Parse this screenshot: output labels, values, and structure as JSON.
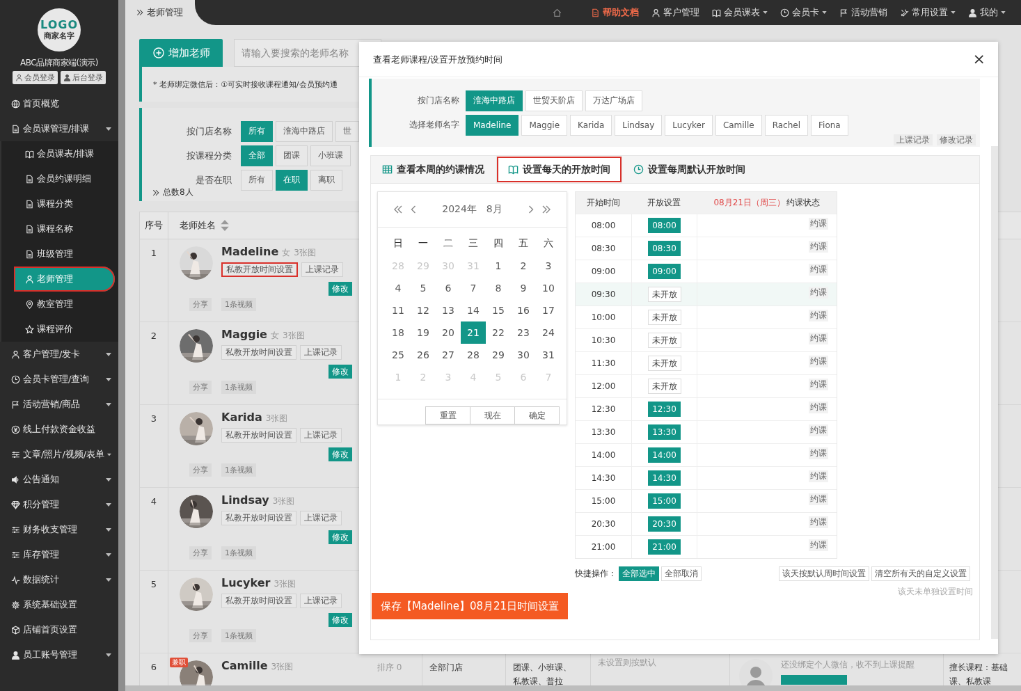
{
  "sidebar": {
    "logo": {
      "mark": "LOGO",
      "name": "商家名字"
    },
    "brand": "ABC品牌商家端(演示)",
    "login_buttons": [
      "会员登录",
      "后台登录"
    ],
    "menu": [
      {
        "label": "首页概览",
        "caret": false
      },
      {
        "label": "会员课管理/排课",
        "caret": true,
        "children": [
          {
            "label": "会员课表/排课",
            "selected": false,
            "highlighted": false
          },
          {
            "label": "会员约课明细",
            "selected": false,
            "highlighted": false
          },
          {
            "label": "课程分类",
            "selected": false,
            "highlighted": false
          },
          {
            "label": "课程名称",
            "selected": false,
            "highlighted": false
          },
          {
            "label": "班级管理",
            "selected": false,
            "highlighted": false
          },
          {
            "label": "老师管理",
            "selected": true,
            "highlighted": true
          },
          {
            "label": "教室管理",
            "selected": false,
            "highlighted": false
          },
          {
            "label": "课程评价",
            "selected": false,
            "highlighted": false
          }
        ]
      },
      {
        "label": "客户管理/发卡",
        "caret": true
      },
      {
        "label": "会员卡管理/查询",
        "caret": true
      },
      {
        "label": "活动营销/商品",
        "caret": true
      },
      {
        "label": "线上付款资金收益",
        "caret": false
      },
      {
        "label": "文章/照片/视频/表单",
        "caret": true
      },
      {
        "label": "公告通知",
        "caret": true
      },
      {
        "label": "积分管理",
        "caret": true
      },
      {
        "label": "财务收支管理",
        "caret": true
      },
      {
        "label": "库存管理",
        "caret": true
      },
      {
        "label": "数据统计",
        "caret": true
      },
      {
        "label": "系统基础设置",
        "caret": false
      },
      {
        "label": "店铺首页设置",
        "caret": false
      },
      {
        "label": "员工账号管理",
        "caret": true
      }
    ]
  },
  "breadcrumb": "老师管理",
  "top_nav": [
    {
      "label": "帮助文档",
      "accent": true,
      "caret": false
    },
    {
      "label": "客户管理",
      "accent": false,
      "caret": false
    },
    {
      "label": "会员课表",
      "accent": false,
      "caret": true
    },
    {
      "label": "会员卡",
      "accent": false,
      "caret": true
    },
    {
      "label": "活动营销",
      "accent": false,
      "caret": false
    },
    {
      "label": "常用设置",
      "accent": false,
      "caret": true
    },
    {
      "label": "我的",
      "accent": false,
      "caret": true
    }
  ],
  "add_button": "增加老师",
  "search": {
    "placeholder": "请输入要搜索的老师名称"
  },
  "notice": "* 老师绑定微信后：①可实时接收课程通知/会员预约通",
  "filters": [
    {
      "label": "按门店名称",
      "options": [
        {
          "label": "所有",
          "selected": true
        },
        {
          "label": "淮海中路店",
          "selected": false
        },
        {
          "label": "世",
          "selected": false
        }
      ]
    },
    {
      "label": "按课程分类",
      "options": [
        {
          "label": "全部",
          "selected": true
        },
        {
          "label": "团课",
          "selected": false
        },
        {
          "label": "小班课",
          "selected": false
        }
      ]
    },
    {
      "label": "是否在职",
      "options": [
        {
          "label": "所有",
          "selected": false
        },
        {
          "label": "在职",
          "selected": true
        },
        {
          "label": "离职",
          "selected": false
        }
      ]
    }
  ],
  "total": "总数8人",
  "table": {
    "columns": [
      "序号",
      "老师姓名"
    ],
    "rows": [
      {
        "index": "1",
        "name": "Madeline",
        "gender": "女",
        "photos": "3张图",
        "schedule_button": "私教开放时间设置",
        "highlighted": true,
        "record_button": "上课记录",
        "edit_button": "修改",
        "share": "分享",
        "video": "1条视频"
      },
      {
        "index": "2",
        "name": "Maggie",
        "gender": "女",
        "photos": "3张图",
        "schedule_button": "私教开放时间设置",
        "highlighted": false,
        "record_button": "上课记录",
        "edit_button": "修改",
        "share": "分享",
        "video": "1条视频"
      },
      {
        "index": "3",
        "name": "Karida",
        "photos": "3张图",
        "schedule_button": "私教开放时间设置",
        "highlighted": false,
        "record_button": "上课记录",
        "edit_button": "修改",
        "share": "分享",
        "video": "1条视频"
      },
      {
        "index": "4",
        "name": "Lindsay",
        "photos": "3张图",
        "schedule_button": "私教开放时间设置",
        "highlighted": false,
        "record_button": "上课记录",
        "edit_button": "修改",
        "share": "分享",
        "video": "1条视频"
      },
      {
        "index": "5",
        "name": "Lucyker",
        "photos": "3张图",
        "schedule_button": "私教开放时间设置",
        "highlighted": false,
        "record_button": "上课记录",
        "edit_button": "修改",
        "share": "分享",
        "video": "1条视频"
      }
    ],
    "partial_row": {
      "index": "6",
      "badge": "兼职",
      "name": "Camille",
      "photos": "3张图",
      "sort": "排序 0",
      "store": "全部门店",
      "courses": [
        "团课、小班课、",
        "私教课、普拉"
      ],
      "open_time": "未设置则按默认",
      "wechat": "还没绑定个人微信，收不到上课提醒",
      "specialty": [
        "擅长课程：基础",
        "课、私教课"
      ]
    }
  },
  "modal": {
    "title": "查看老师课程/设置开放预约时间",
    "close": "×",
    "store_filter": {
      "label": "按门店名称",
      "options": [
        {
          "label": "淮海中路店",
          "selected": true
        },
        {
          "label": "世贸天阶店",
          "selected": false
        },
        {
          "label": "万达广场店",
          "selected": false
        }
      ]
    },
    "teacher_filter": {
      "label": "选择老师名字",
      "options": [
        {
          "label": "Madeline",
          "selected": true
        },
        {
          "label": "Maggie",
          "selected": false
        },
        {
          "label": "Karida",
          "selected": false
        },
        {
          "label": "Lindsay",
          "selected": false
        },
        {
          "label": "Lucyker",
          "selected": false
        },
        {
          "label": "Camille",
          "selected": false
        },
        {
          "label": "Rachel",
          "selected": false
        },
        {
          "label": "Fiona",
          "selected": false
        }
      ]
    },
    "record_links": [
      "上课记录",
      "修改记录"
    ],
    "tabs": [
      {
        "label": "查看本周的约课情况",
        "selected": false,
        "highlighted": false
      },
      {
        "label": "设置每天的开放时间",
        "selected": true,
        "highlighted": true
      },
      {
        "label": "设置每周默认开放时间",
        "selected": false,
        "highlighted": false
      }
    ],
    "calendar": {
      "year": "2024年",
      "month": "8月",
      "weekdays": [
        "日",
        "一",
        "二",
        "三",
        "四",
        "五",
        "六"
      ],
      "weeks": [
        [
          {
            "day": "28",
            "other": true,
            "selected": false
          },
          {
            "day": "29",
            "other": true,
            "selected": false
          },
          {
            "day": "30",
            "other": true,
            "selected": false
          },
          {
            "day": "31",
            "other": true,
            "selected": false
          },
          {
            "day": "1",
            "other": false,
            "selected": false
          },
          {
            "day": "2",
            "other": false,
            "selected": false
          },
          {
            "day": "3",
            "other": false,
            "selected": false
          }
        ],
        [
          {
            "day": "4",
            "other": false,
            "selected": false
          },
          {
            "day": "5",
            "other": false,
            "selected": false
          },
          {
            "day": "6",
            "other": false,
            "selected": false
          },
          {
            "day": "7",
            "other": false,
            "selected": false
          },
          {
            "day": "8",
            "other": false,
            "selected": false
          },
          {
            "day": "9",
            "other": false,
            "selected": false
          },
          {
            "day": "10",
            "other": false,
            "selected": false
          }
        ],
        [
          {
            "day": "11",
            "other": false,
            "selected": false
          },
          {
            "day": "12",
            "other": false,
            "selected": false
          },
          {
            "day": "13",
            "other": false,
            "selected": false
          },
          {
            "day": "14",
            "other": false,
            "selected": false
          },
          {
            "day": "15",
            "other": false,
            "selected": false
          },
          {
            "day": "16",
            "other": false,
            "selected": false
          },
          {
            "day": "17",
            "other": false,
            "selected": false
          }
        ],
        [
          {
            "day": "18",
            "other": false,
            "selected": false
          },
          {
            "day": "19",
            "other": false,
            "selected": false
          },
          {
            "day": "20",
            "other": false,
            "selected": false
          },
          {
            "day": "21",
            "other": false,
            "selected": true
          },
          {
            "day": "22",
            "other": false,
            "selected": false
          },
          {
            "day": "23",
            "other": false,
            "selected": false
          },
          {
            "day": "24",
            "other": false,
            "selected": false
          }
        ],
        [
          {
            "day": "25",
            "other": false,
            "selected": false
          },
          {
            "day": "26",
            "other": false,
            "selected": false
          },
          {
            "day": "27",
            "other": false,
            "selected": false
          },
          {
            "day": "28",
            "other": false,
            "selected": false
          },
          {
            "day": "29",
            "other": false,
            "selected": false
          },
          {
            "day": "30",
            "other": false,
            "selected": false
          },
          {
            "day": "31",
            "other": false,
            "selected": false
          }
        ],
        [
          {
            "day": "1",
            "other": true,
            "selected": false
          },
          {
            "day": "2",
            "other": true,
            "selected": false
          },
          {
            "day": "3",
            "other": true,
            "selected": false
          },
          {
            "day": "4",
            "other": true,
            "selected": false
          },
          {
            "day": "5",
            "other": true,
            "selected": false
          },
          {
            "day": "6",
            "other": true,
            "selected": false
          },
          {
            "day": "7",
            "other": true,
            "selected": false
          }
        ]
      ],
      "buttons": [
        "重置",
        "现在",
        "确定"
      ]
    },
    "times": {
      "columns": [
        "开始时间",
        "开放设置"
      ],
      "date_label": "08月21日（周三）",
      "status_label": "约课状态",
      "rows": [
        {
          "time": "08:00",
          "open": true,
          "setting": "08:00",
          "status": "约课",
          "hovered": false
        },
        {
          "time": "08:30",
          "open": true,
          "setting": "08:30",
          "status": "约课",
          "hovered": false
        },
        {
          "time": "09:00",
          "open": true,
          "setting": "09:00",
          "status": "约课",
          "hovered": false
        },
        {
          "time": "09:30",
          "open": false,
          "setting": "未开放",
          "status": "约课",
          "hovered": true
        },
        {
          "time": "10:00",
          "open": false,
          "setting": "未开放",
          "status": "约课",
          "hovered": false
        },
        {
          "time": "10:30",
          "open": false,
          "setting": "未开放",
          "status": "约课",
          "hovered": false
        },
        {
          "time": "11:30",
          "open": false,
          "setting": "未开放",
          "status": "约课",
          "hovered": false
        },
        {
          "time": "12:00",
          "open": false,
          "setting": "未开放",
          "status": "约课",
          "hovered": false
        },
        {
          "time": "12:30",
          "open": true,
          "setting": "12:30",
          "status": "约课",
          "hovered": false
        },
        {
          "time": "13:30",
          "open": true,
          "setting": "13:30",
          "status": "约课",
          "hovered": false
        },
        {
          "time": "14:00",
          "open": true,
          "setting": "14:00",
          "status": "约课",
          "hovered": false
        },
        {
          "time": "14:30",
          "open": true,
          "setting": "14:30",
          "status": "约课",
          "hovered": false
        },
        {
          "time": "15:00",
          "open": true,
          "setting": "15:00",
          "status": "约课",
          "hovered": false
        },
        {
          "time": "20:30",
          "open": true,
          "setting": "20:30",
          "status": "约课",
          "hovered": false
        },
        {
          "time": "21:00",
          "open": true,
          "setting": "21:00",
          "status": "约课",
          "hovered": false
        }
      ]
    },
    "quick_label": "快捷操作：",
    "quick_buttons": [
      {
        "label": "全部选中",
        "primary": true
      },
      {
        "label": "全部取消",
        "primary": false
      }
    ],
    "day_buttons": [
      "该天按默认周时间设置",
      "清空所有天的自定义设置"
    ],
    "day_note": "该天未单独设置时间",
    "save_button": "保存【Madeline】08月21日时间设置"
  }
}
